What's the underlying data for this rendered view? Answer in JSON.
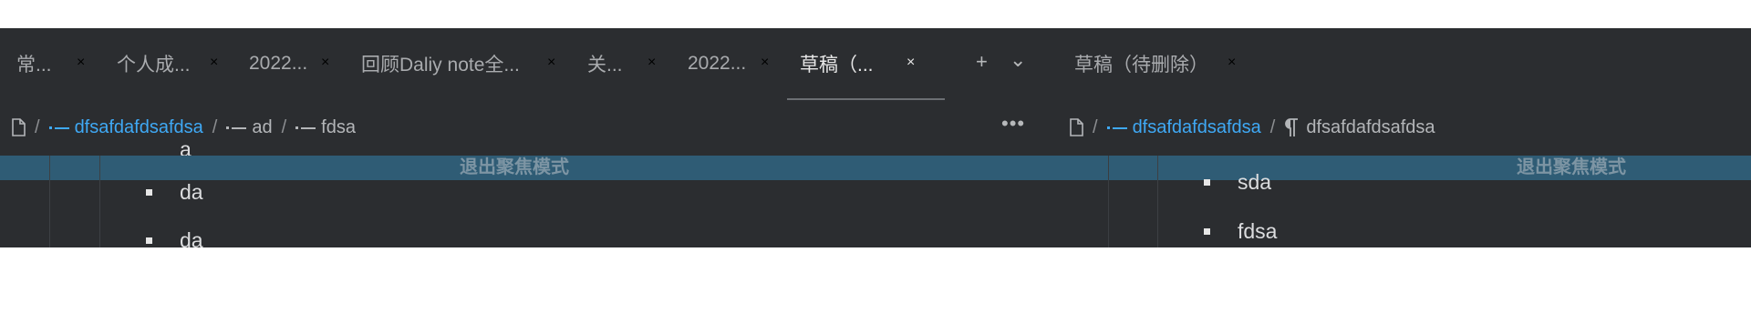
{
  "left_tabs": [
    {
      "label": "常...",
      "close": "×"
    },
    {
      "label": "个人成...",
      "close": "×"
    },
    {
      "label": "2022...",
      "close": "×"
    },
    {
      "label": "回顾Daliy note全...",
      "close": "×"
    },
    {
      "label": "关...",
      "close": "×"
    },
    {
      "label": "2022...",
      "close": "×"
    },
    {
      "label": "草稿（...",
      "close": "×",
      "active": true
    }
  ],
  "tab_actions": {
    "new_tab": "+",
    "dropdown": "⌄"
  },
  "right_tabs": [
    {
      "label": "草稿（待删除）",
      "close": "×"
    }
  ],
  "left_breadcrumb": {
    "sep": "/",
    "items": [
      "dfsafdafdsafdsa",
      "ad",
      "fdsa"
    ]
  },
  "more_menu": "•••",
  "right_breadcrumb": {
    "sep": "/",
    "items": [
      "dfsafdafdsafdsa",
      "dfsafdafdsafdsa"
    ]
  },
  "focus_mode": {
    "label": "退出聚焦模式"
  },
  "left_content": {
    "partial_top": "a",
    "items": [
      "da",
      "da"
    ]
  },
  "right_content": {
    "items": [
      "sda",
      "fdsa"
    ]
  },
  "colors": {
    "background": "#2b2d30",
    "link": "#3fa9f5",
    "focus_bar": "#2f5c75",
    "text": "#dcdddf"
  },
  "icons": {
    "file": "file-icon",
    "bullet": "bullet-line-icon",
    "paragraph": "paragraph-icon"
  }
}
